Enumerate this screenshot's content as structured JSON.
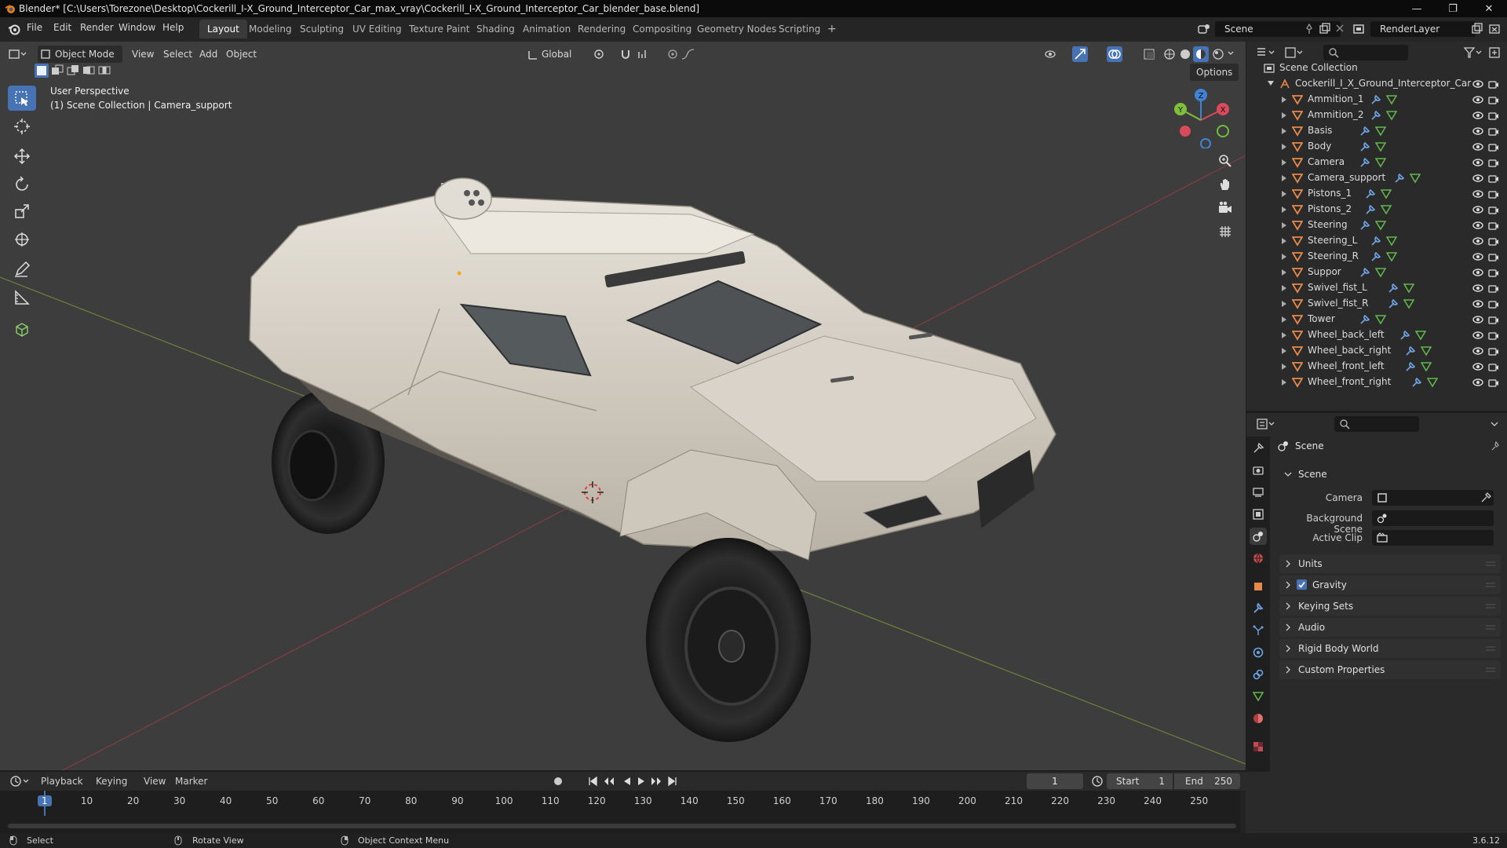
{
  "window": {
    "title": "Blender* [C:\\Users\\Torezone\\Desktop\\Cockerill_I-X_Ground_Interceptor_Car_max_vray\\Cockerill_I-X_Ground_Interceptor_Car_blender_base.blend]",
    "minimize": "—",
    "restore": "❐",
    "close": "✕"
  },
  "menu": [
    "File",
    "Edit",
    "Render",
    "Window",
    "Help"
  ],
  "workspaces": [
    "Layout",
    "Modeling",
    "Sculpting",
    "UV Editing",
    "Texture Paint",
    "Shading",
    "Animation",
    "Rendering",
    "Compositing",
    "Geometry Nodes",
    "Scripting"
  ],
  "add_workspace": "+",
  "scene_field": "Scene",
  "renderlayer_field": "RenderLayer",
  "viewport": {
    "mode": "Object Mode",
    "menus": [
      "View",
      "Select",
      "Add",
      "Object"
    ],
    "orientation": "Global",
    "options": "Options",
    "overlay_title": "User Perspective",
    "overlay_subtitle": "(1) Scene Collection | Camera_support",
    "gizmo": {
      "x": "X",
      "y": "Y",
      "z": "Z"
    }
  },
  "outliner": {
    "root": "Scene Collection",
    "collection": "Cockerill_I_X_Ground_Interceptor_Car",
    "items": [
      "Ammition_1",
      "Ammition_2",
      "Basis",
      "Body",
      "Camera",
      "Camera_support",
      "Pistons_1",
      "Pistons_2",
      "Steering",
      "Steering_L",
      "Steering_R",
      "Suppor",
      "Swivel_fist_L",
      "Swivel_fist_R",
      "Tower",
      "Wheel_back_left",
      "Wheel_back_right",
      "Wheel_front_left",
      "Wheel_front_right"
    ]
  },
  "properties": {
    "context": "Scene",
    "section": "Scene",
    "camera_label": "Camera",
    "bg_scene_label": "Background Scene",
    "active_clip_label": "Active Clip",
    "panels": [
      "Units",
      "Gravity",
      "Keying Sets",
      "Audio",
      "Rigid Body World",
      "Custom Properties"
    ]
  },
  "timeline": {
    "menus": [
      "Playback",
      "Keying",
      "View",
      "Marker"
    ],
    "current_frame": "1",
    "start_label": "Start",
    "start_value": "1",
    "end_label": "End",
    "end_value": "250",
    "ticks": [
      "1",
      "10",
      "20",
      "30",
      "40",
      "50",
      "60",
      "70",
      "80",
      "90",
      "100",
      "110",
      "120",
      "130",
      "140",
      "150",
      "160",
      "170",
      "180",
      "190",
      "200",
      "210",
      "220",
      "230",
      "240",
      "250"
    ]
  },
  "status": {
    "select": "Select",
    "rotate": "Rotate View",
    "context_menu": "Object Context Menu",
    "version": "3.6.12"
  },
  "colors": {
    "accent": "#4772b3",
    "object_orange": "#e8884a",
    "mesh_green": "#62b54c",
    "modifier_blue": "#6fa4e5",
    "x_axis": "#d94a5a",
    "y_axis": "#7fbf3a",
    "z_axis": "#3f82d6"
  }
}
